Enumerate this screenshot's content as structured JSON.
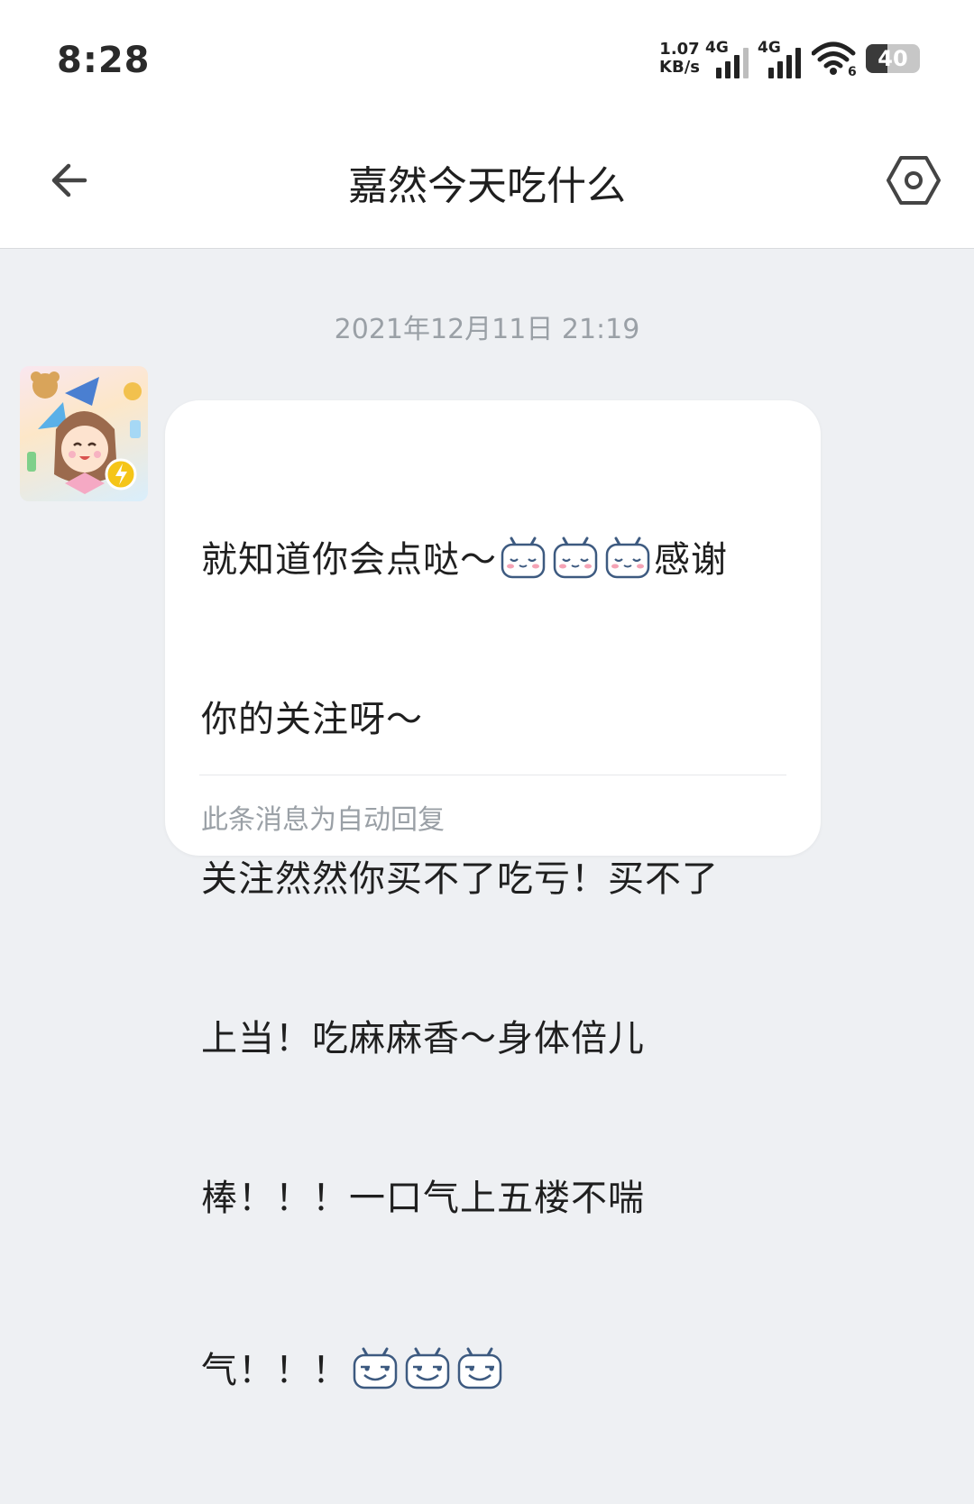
{
  "status_bar": {
    "time": "8:28",
    "net_speed_value": "1.07",
    "net_speed_unit": "KB/s",
    "sim1_label": "4G",
    "sim2_label": "4G",
    "wifi_badge": "6",
    "battery_level": "40",
    "battery_fraction": 0.4
  },
  "header": {
    "title": "嘉然今天吃什么",
    "icons": {
      "back": "arrow-left-icon",
      "settings": "hexagon-settings-icon"
    }
  },
  "conversation": {
    "timestamp": "2021年12月11日 21:19",
    "message": {
      "line1_a": "就知道你会点哒～",
      "line1_b": "感谢",
      "line2": "你的关注呀～",
      "line3": "关注然然你买不了吃亏！买不了",
      "line4": "上当！吃麻麻香～身体倍儿",
      "line5": "棒！！！一口气上五楼不喘",
      "line6": "气！！！",
      "emotes_shy": [
        "tv-shy-emote",
        "tv-shy-emote",
        "tv-shy-emote"
      ],
      "emotes_smirk": [
        "tv-smirk-emote",
        "tv-smirk-emote",
        "tv-smirk-emote"
      ]
    },
    "auto_reply_note": "此条消息为自动回复"
  },
  "colors": {
    "background": "#eef0f3",
    "bubble": "#ffffff",
    "muted_text": "#9aa0a6",
    "primary_text": "#1f1f1f"
  }
}
